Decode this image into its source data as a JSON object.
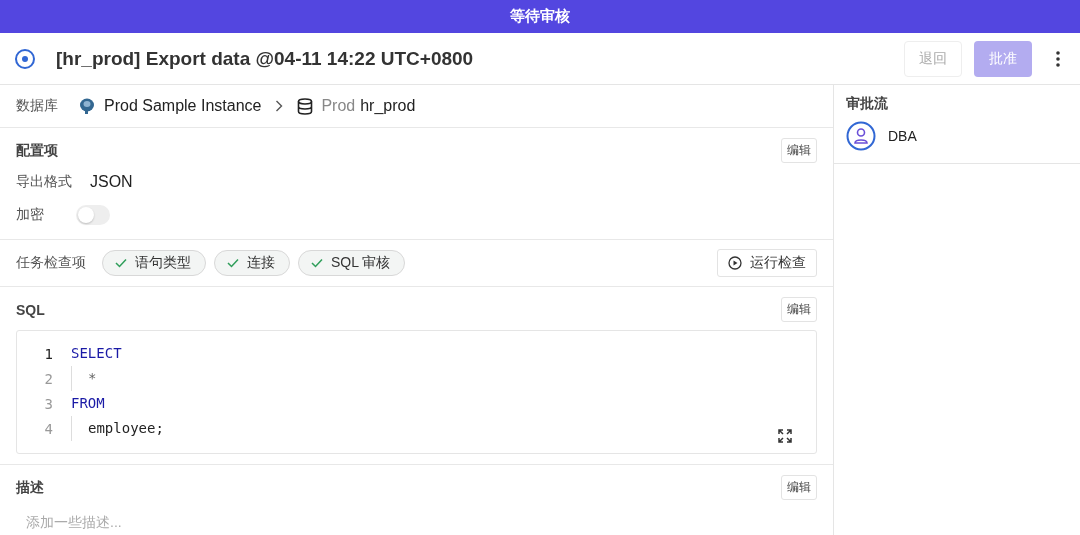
{
  "banner": {
    "text": "等待审核"
  },
  "header": {
    "title": "[hr_prod] Export data @04-11 14:22 UTC+0800",
    "buttons": [
      {
        "label": "退回",
        "kind": "secondary",
        "disabled": true
      },
      {
        "label": "批准",
        "kind": "primary",
        "disabled": true
      }
    ]
  },
  "database": {
    "label": "数据库",
    "instance": "Prod Sample Instance",
    "environment": "Prod",
    "name": "hr_prod"
  },
  "config": {
    "title": "配置项",
    "edit": "编辑",
    "fields": [
      {
        "kind": "text",
        "label": "导出格式",
        "value": "JSON"
      },
      {
        "kind": "switch",
        "label": "加密",
        "on": false
      }
    ]
  },
  "checks": {
    "label": "任务检查项",
    "items": [
      {
        "label": "语句类型",
        "passed": true
      },
      {
        "label": "连接",
        "passed": true
      },
      {
        "label": "SQL 审核",
        "passed": true
      }
    ],
    "run_button": "运行检查"
  },
  "sql": {
    "title": "SQL",
    "edit": "编辑",
    "lines": [
      {
        "number": "1",
        "text": "SELECT",
        "kind": "keyword",
        "indent": false,
        "active": true
      },
      {
        "number": "2",
        "text": "*",
        "kind": "operator",
        "indent": true,
        "active": false
      },
      {
        "number": "3",
        "text": "FROM",
        "kind": "keyword",
        "indent": false,
        "active": false
      },
      {
        "number": "4",
        "text": "employee;",
        "kind": "plain",
        "indent": true,
        "active": false
      }
    ]
  },
  "description": {
    "title": "描述",
    "edit": "编辑",
    "placeholder": "添加一些描述..."
  },
  "approval_flow": {
    "title": "审批流",
    "steps": [
      {
        "name": "DBA"
      }
    ]
  }
}
